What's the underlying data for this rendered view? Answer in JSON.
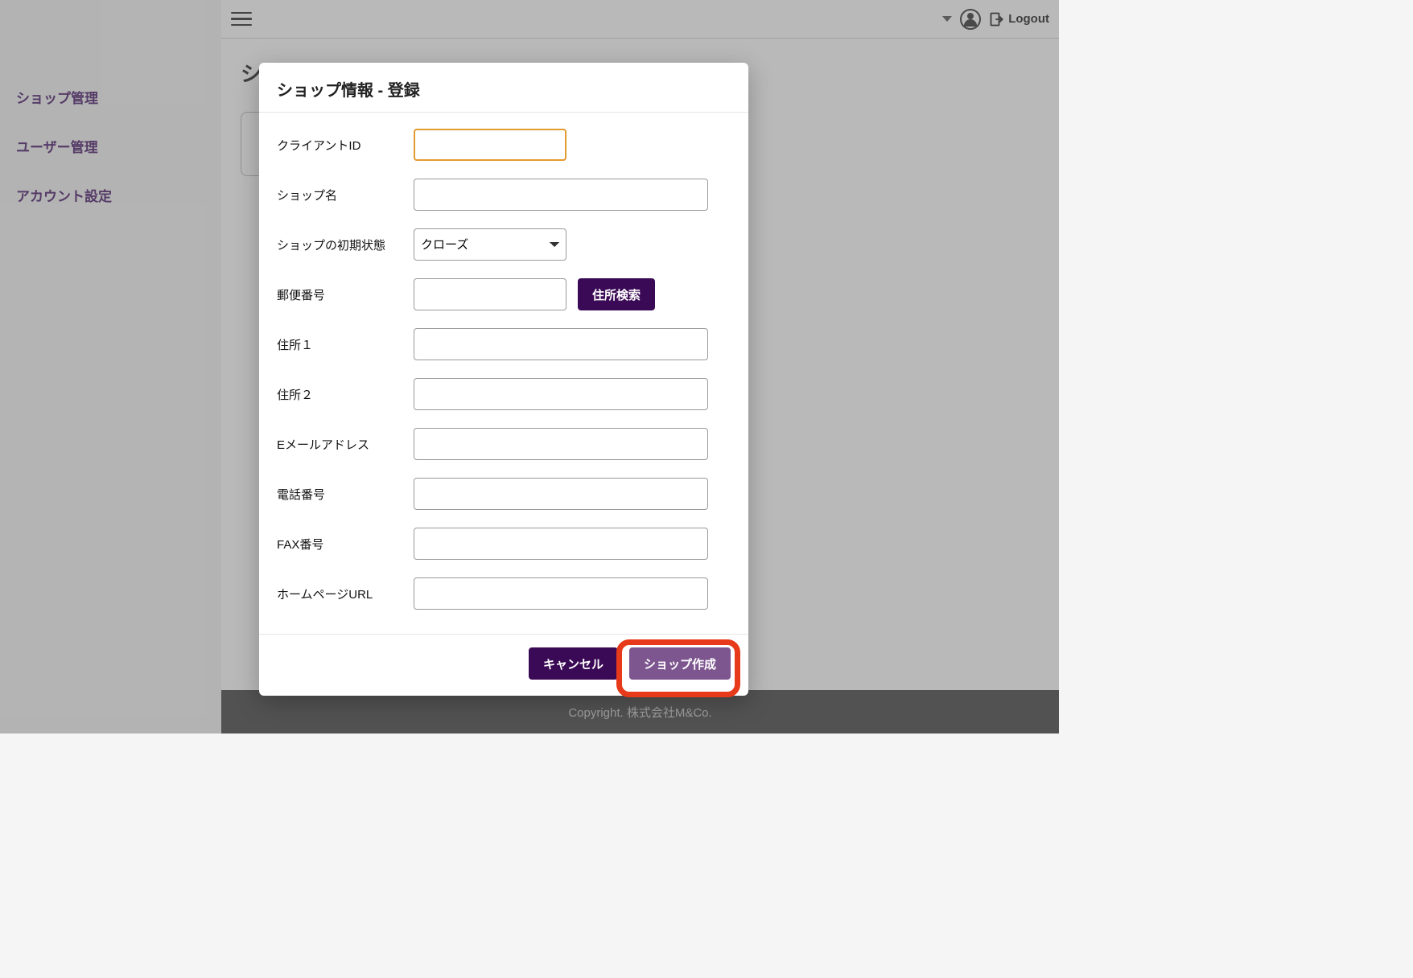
{
  "sidebar": {
    "items": [
      {
        "label": "ショップ管理"
      },
      {
        "label": "ユーザー管理"
      },
      {
        "label": "アカウント設定"
      }
    ]
  },
  "topbar": {
    "logout_label": "Logout"
  },
  "page": {
    "title_partial": "ショ"
  },
  "modal": {
    "title": "ショップ情報 - 登録",
    "fields": {
      "client_id": {
        "label": "クライアントID",
        "value": ""
      },
      "shop_name": {
        "label": "ショップ名",
        "value": ""
      },
      "initial_state": {
        "label": "ショップの初期状態",
        "selected": "クローズ"
      },
      "zip": {
        "label": "郵便番号",
        "value": "",
        "search_label": "住所検索"
      },
      "address1": {
        "label": "住所１",
        "value": ""
      },
      "address2": {
        "label": "住所２",
        "value": ""
      },
      "email": {
        "label": "Eメールアドレス",
        "value": ""
      },
      "phone": {
        "label": "電話番号",
        "value": ""
      },
      "fax": {
        "label": "FAX番号",
        "value": ""
      },
      "homepage": {
        "label": "ホームページURL",
        "value": ""
      }
    },
    "buttons": {
      "cancel": "キャンセル",
      "create": "ショップ作成"
    }
  },
  "footer": {
    "text": "Copyright. 株式会社M&Co."
  }
}
